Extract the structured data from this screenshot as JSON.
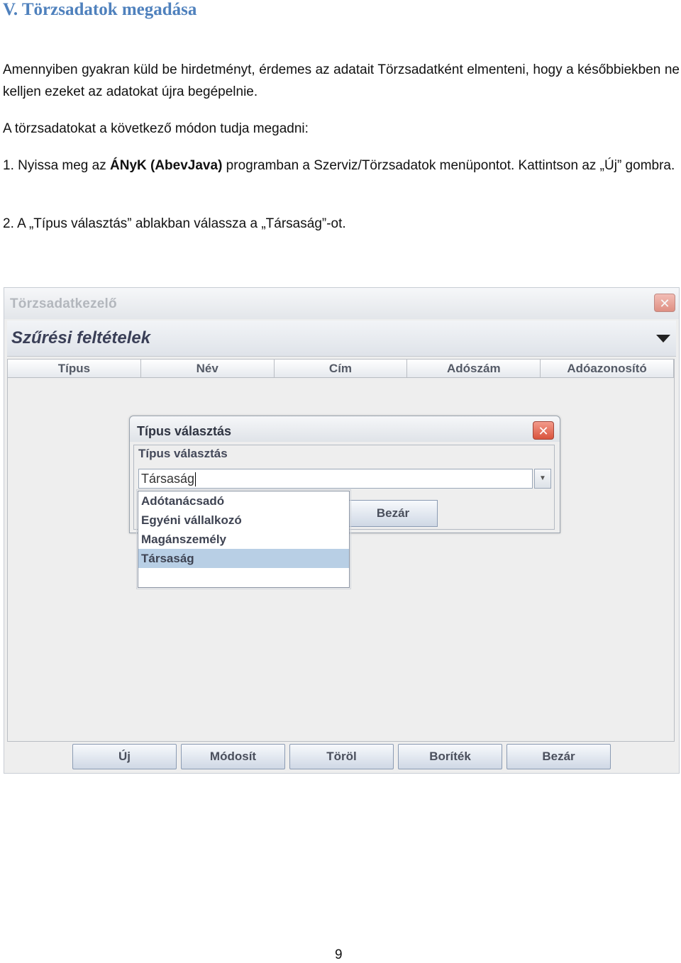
{
  "heading": "V. Törzsadatok megadása",
  "paragraphs": {
    "p1": "Amennyiben gyakran küld be hirdetményt, érdemes az adatait Törzsadatként elmenteni, hogy a későbbiekben ne kelljen ezeket az adatokat újra begépelnie.",
    "p2": "A törzsadatokat a következő módon tudja megadni:",
    "p3_before": "1. Nyissa meg az ",
    "p3_bold": "ÁNyK (AbevJava)",
    "p3_after": " programban a Szerviz/Törzsadatok menüpontot. Kattintson az „Új” gombra.",
    "p4": "2. A „Típus választás” ablakban válassza a „Társaság”-ot."
  },
  "window": {
    "title": "Törzsadatkezelő",
    "close_glyph": "✕",
    "filter_title": "Szűrési feltételek",
    "columns": [
      "Típus",
      "Név",
      "Cím",
      "Adószám",
      "Adóazonosító"
    ],
    "buttons": [
      "Új",
      "Módosít",
      "Töröl",
      "Boríték",
      "Bezár"
    ]
  },
  "dialog": {
    "title": "Típus választás",
    "close_glyph": "✕",
    "group_label": "Típus választás",
    "combo_value": "Társaság",
    "combo_arrow": "▼",
    "close_button": "Bezár",
    "options": [
      "Adótanácsadó",
      "Egyéni vállalkozó",
      "Magánszemély",
      "Társaság"
    ],
    "selected_index": 3
  },
  "page_number": "9"
}
